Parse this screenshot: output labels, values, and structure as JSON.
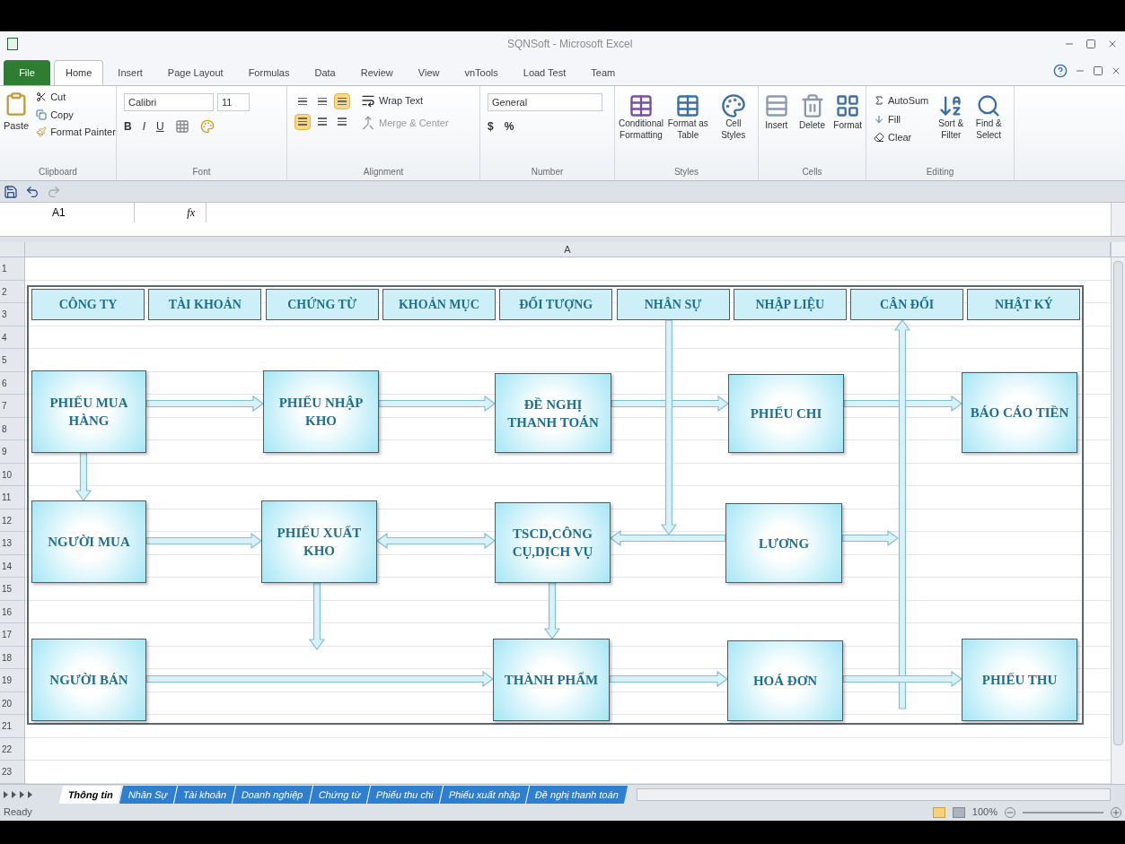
{
  "window": {
    "title": "SQNSoft - Microsoft Excel"
  },
  "ribbon_tabs": [
    {
      "label": "File",
      "kind": "file",
      "selected": false
    },
    {
      "label": "Home",
      "kind": "tab",
      "selected": true
    },
    {
      "label": "Insert",
      "kind": "tab",
      "selected": false
    },
    {
      "label": "Page Layout",
      "kind": "tab",
      "selected": false
    },
    {
      "label": "Formulas",
      "kind": "tab",
      "selected": false
    },
    {
      "label": "Data",
      "kind": "tab",
      "selected": false
    },
    {
      "label": "Review",
      "kind": "tab",
      "selected": false
    },
    {
      "label": "View",
      "kind": "tab",
      "selected": false
    },
    {
      "label": "vnTools",
      "kind": "tab",
      "selected": false
    },
    {
      "label": "Load Test",
      "kind": "tab",
      "selected": false
    },
    {
      "label": "Team",
      "kind": "tab",
      "selected": false
    }
  ],
  "ribbon": {
    "clipboard": {
      "label": "Clipboard",
      "paste": "Paste",
      "cut": "Cut",
      "copy": "Copy",
      "format_painter": "Format Painter"
    },
    "font": {
      "label": "Font",
      "name": "Calibri",
      "size": "11",
      "bold": "B",
      "italic": "I",
      "underline": "U"
    },
    "alignment": {
      "label": "Alignment",
      "wrap_text": "Wrap Text",
      "merge": "Merge & Center"
    },
    "number": {
      "label": "Number",
      "format": "General",
      "currency": "$",
      "percent": "%"
    },
    "styles": {
      "label": "Styles",
      "buttons": [
        "Conditional Formatting",
        "Format as Table",
        "Cell Styles"
      ]
    },
    "cells": {
      "label": "Cells",
      "buttons": [
        "Insert",
        "Delete",
        "Format"
      ]
    },
    "editing": {
      "label": "Editing",
      "autosum": "AutoSum",
      "fill": "Fill",
      "clear": "Clear",
      "buttons": [
        "Sort & Filter",
        "Find & Select"
      ]
    }
  },
  "formula_bar": {
    "name_box": "A1",
    "fx": "fx"
  },
  "column_header": "A",
  "row_numbers": [
    "1",
    "2",
    "3",
    "4",
    "5",
    "6",
    "7",
    "8",
    "9",
    "10",
    "11",
    "12",
    "13",
    "14",
    "15",
    "16",
    "17",
    "18",
    "19",
    "20",
    "21",
    "22",
    "23"
  ],
  "diagram": {
    "headers": [
      "CÔNG TY",
      "TÀI KHOẢN",
      "CHỨNG TỪ",
      "KHOẢN MỤC",
      "ĐỐI TƯỢNG",
      "NHÂN SỰ",
      "NHẬP LIỆU",
      "CÂN ĐỐI",
      "NHẬT KÝ"
    ],
    "nodes": [
      {
        "label": "PHIẾU MUA HÀNG"
      },
      {
        "label": "PHIẾU NHẬP KHO"
      },
      {
        "label": "ĐỀ NGHỊ THANH TOÁN"
      },
      {
        "label": "PHIẾU CHI"
      },
      {
        "label": "BÁO CÁO TIỀN"
      },
      {
        "label": "NGƯỜI MUA"
      },
      {
        "label": "PHIẾU XUẤT KHO"
      },
      {
        "label": "TSCD,CÔNG CỤ,DỊCH VỤ"
      },
      {
        "label": "LƯƠNG"
      },
      {
        "label": "NGƯỜI BÁN"
      },
      {
        "label": "THÀNH PHẨM"
      },
      {
        "label": "HOÁ ĐƠN"
      },
      {
        "label": "PHIẾU THU"
      }
    ]
  },
  "sheet_tabs": [
    {
      "label": "Thông tin",
      "selected": true
    },
    {
      "label": "Nhân Sự",
      "selected": false
    },
    {
      "label": "Tài khoản",
      "selected": false
    },
    {
      "label": "Doanh nghiệp",
      "selected": false
    },
    {
      "label": "Chứng từ",
      "selected": false
    },
    {
      "label": "Phiếu thu chi",
      "selected": false
    },
    {
      "label": "Phiếu xuất nhập",
      "selected": false
    },
    {
      "label": "Đề nghị thanh toán",
      "selected": false
    }
  ],
  "status_bar": {
    "status": "Ready",
    "zoom": "100%"
  }
}
